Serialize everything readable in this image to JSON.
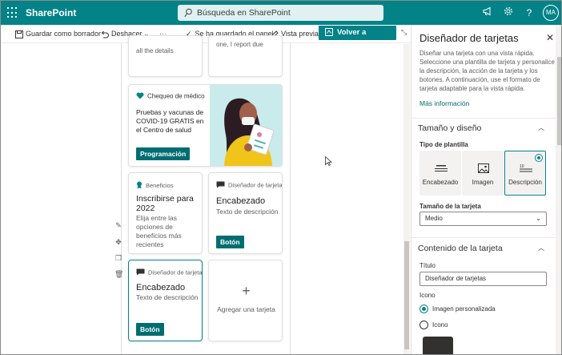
{
  "suitebar": {
    "app_name": "SharePoint",
    "search_placeholder": "Búsqueda en SharePoint",
    "avatar_initials": "MA",
    "accent": "#038387"
  },
  "commandbar": {
    "save_draft": "Guardar como borrador",
    "undo": "Deshacer",
    "saved_status": "Se ha guardado el panel",
    "preview": "Vista previa",
    "republish": "Volver a publicar"
  },
  "cards": {
    "partial_left_text": "all the details",
    "partial_right_text": "one, I report due",
    "health": {
      "eyebrow": "Chequeo de médico",
      "heading": "Pruebas y vacunas de COVID-19 GRATIS en el Centro de salud",
      "button": "Programación"
    },
    "benefits": {
      "eyebrow": "Beneficios",
      "heading": "Inscribirse para 2022",
      "desc": "Elija entre las opciones de beneficios más recientes"
    },
    "designer1": {
      "eyebrow": "Diseñador de tarjetas",
      "heading": "Encabezado",
      "desc": "Texto de descripción",
      "button": "Botón"
    },
    "designer2": {
      "eyebrow": "Diseñador de tarjetas",
      "heading": "Encabezado",
      "desc": "Texto de descripción",
      "button": "Botón"
    },
    "add_card": "Agregar una tarjeta"
  },
  "pane": {
    "title": "Diseñador de tarjetas",
    "intro": "Diseñar una tarjeta con una vista rápida. Seleccione una plantilla de tarjeta y personalice la descripción, la acción de la tarjeta y los botones. A continuación, use el formato de tarjeta adaptable para la vista rápida.",
    "more_info": "Más información",
    "size_section": "Tamaño y diseño",
    "template_type": "Tipo de plantilla",
    "templates": [
      "Encabezado",
      "Imagen",
      "Descripción"
    ],
    "selected_template": "Descripción",
    "card_size_label": "Tamaño de la tarjeta",
    "card_size_value": "Medio",
    "content_section": "Contenido de la tarjeta",
    "title_label": "Título",
    "title_value": "Diseñador de tarjetas",
    "icon_label": "Icono",
    "icon_options": [
      "Imagen personalizada",
      "Icono"
    ],
    "icon_selected": "Imagen personalizada"
  }
}
